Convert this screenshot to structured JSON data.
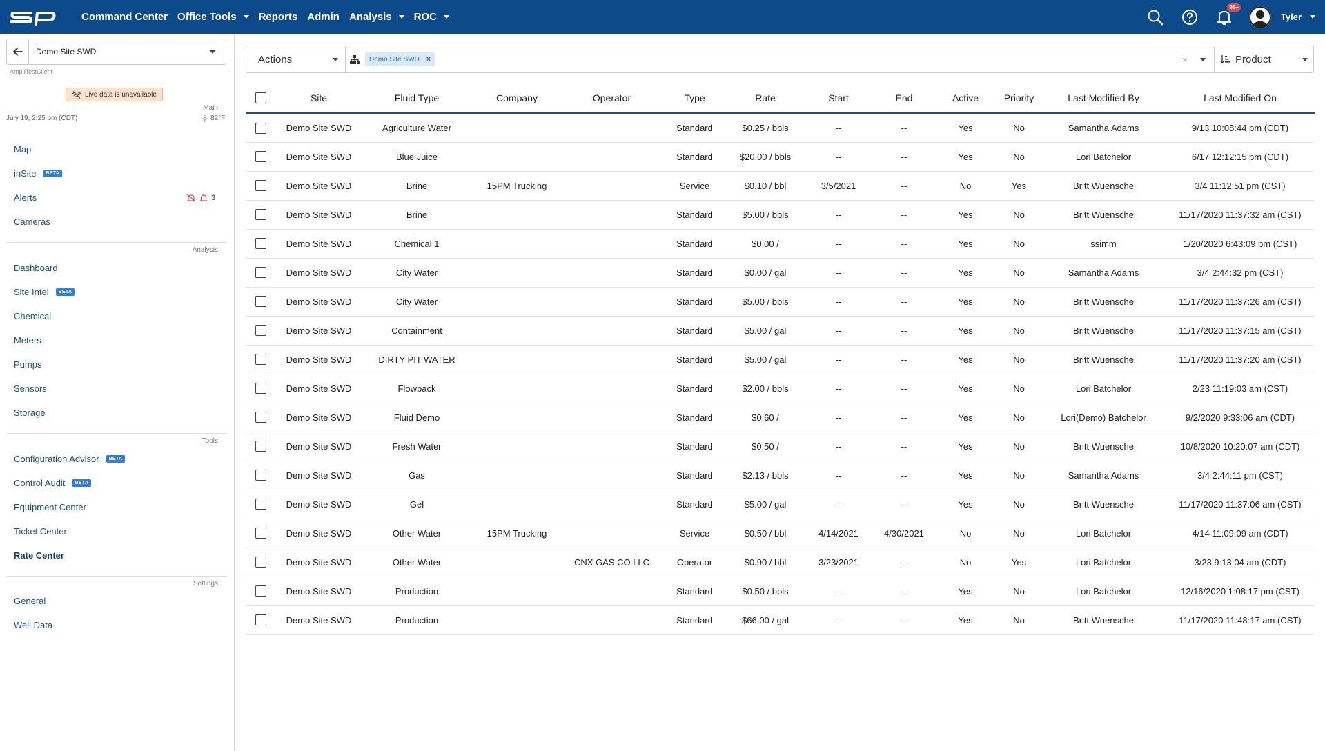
{
  "nav": {
    "items": [
      {
        "label": "Command Center",
        "caret": false
      },
      {
        "label": "Office Tools",
        "caret": true
      },
      {
        "label": "Reports",
        "caret": false
      },
      {
        "label": "Admin",
        "caret": false
      },
      {
        "label": "Analysis",
        "caret": true
      },
      {
        "label": "ROC",
        "caret": true
      }
    ],
    "notification_count": "99+",
    "user": "Tyler"
  },
  "sidebar": {
    "site": "Demo Site SWD",
    "client": "AmpliTestClient",
    "live_status": "Live data is unavailable",
    "datetime": "July 19, 2:25 pm (CDT)",
    "temperature": "82°F",
    "sections": {
      "main": "Main",
      "analysis": "Analysis",
      "tools": "Tools",
      "settings": "Settings"
    },
    "main_items": [
      {
        "label": "Map",
        "beta": false
      },
      {
        "label": "inSite",
        "beta": true
      },
      {
        "label": "Alerts",
        "beta": false
      },
      {
        "label": "Cameras",
        "beta": false
      }
    ],
    "alerts_count": "3",
    "analysis_items": [
      {
        "label": "Dashboard",
        "beta": false
      },
      {
        "label": "Site Intel",
        "beta": true
      },
      {
        "label": "Chemical",
        "beta": false
      },
      {
        "label": "Meters",
        "beta": false
      },
      {
        "label": "Pumps",
        "beta": false
      },
      {
        "label": "Sensors",
        "beta": false
      },
      {
        "label": "Storage",
        "beta": false
      }
    ],
    "tools_items": [
      {
        "label": "Configuration Advisor",
        "beta": true
      },
      {
        "label": "Control Audit",
        "beta": true
      },
      {
        "label": "Equipment Center",
        "beta": false
      },
      {
        "label": "Ticket Center",
        "beta": false
      },
      {
        "label": "Rate Center",
        "beta": false,
        "active": true
      }
    ],
    "settings_items": [
      {
        "label": "General",
        "beta": false
      },
      {
        "label": "Well Data",
        "beta": false
      }
    ],
    "beta_label": "BETA"
  },
  "toolbar": {
    "actions_label": "Actions",
    "filter_chip": "Demo Site SWD",
    "clear": "×",
    "group_label": "Product"
  },
  "table": {
    "headers": [
      "Site",
      "Fluid Type",
      "Company",
      "Operator",
      "Type",
      "Rate",
      "Start",
      "End",
      "Active",
      "Priority",
      "Last Modified By",
      "Last Modified On"
    ],
    "rows": [
      [
        "Demo Site SWD",
        "Agriculture Water",
        "",
        "",
        "Standard",
        "$0.25 / bbls",
        "--",
        "--",
        "Yes",
        "No",
        "Samantha Adams",
        "9/13 10:08:44 pm (CDT)"
      ],
      [
        "Demo Site SWD",
        "Blue Juice",
        "",
        "",
        "Standard",
        "$20.00 / bbls",
        "--",
        "--",
        "Yes",
        "No",
        "Lori Batchelor",
        "6/17 12:12:15 pm (CDT)"
      ],
      [
        "Demo Site SWD",
        "Brine",
        "15PM Trucking",
        "",
        "Service",
        "$0.10 / bbl",
        "3/5/2021",
        "--",
        "No",
        "Yes",
        "Britt Wuensche",
        "3/4 11:12:51 pm (CST)"
      ],
      [
        "Demo Site SWD",
        "Brine",
        "",
        "",
        "Standard",
        "$5.00 / bbls",
        "--",
        "--",
        "Yes",
        "No",
        "Britt Wuensche",
        "11/17/2020 11:37:32 am (CST)"
      ],
      [
        "Demo Site SWD",
        "Chemical 1",
        "",
        "",
        "Standard",
        "$0.00 /",
        "--",
        "--",
        "Yes",
        "No",
        "ssimm",
        "1/20/2020 6:43:09 pm (CST)"
      ],
      [
        "Demo Site SWD",
        "City Water",
        "",
        "",
        "Standard",
        "$0.00 / gal",
        "--",
        "--",
        "Yes",
        "No",
        "Samantha Adams",
        "3/4 2:44:32 pm (CST)"
      ],
      [
        "Demo Site SWD",
        "City Water",
        "",
        "",
        "Standard",
        "$5.00 / bbls",
        "--",
        "--",
        "Yes",
        "No",
        "Britt Wuensche",
        "11/17/2020 11:37:26 am (CST)"
      ],
      [
        "Demo Site SWD",
        "Containment",
        "",
        "",
        "Standard",
        "$5.00 / gal",
        "--",
        "--",
        "Yes",
        "No",
        "Britt Wuensche",
        "11/17/2020 11:37:15 am (CST)"
      ],
      [
        "Demo Site SWD",
        "DIRTY PIT WATER",
        "",
        "",
        "Standard",
        "$5.00 / gal",
        "--",
        "--",
        "Yes",
        "No",
        "Britt Wuensche",
        "11/17/2020 11:37:20 am (CST)"
      ],
      [
        "Demo Site SWD",
        "Flowback",
        "",
        "",
        "Standard",
        "$2.00 / bbls",
        "--",
        "--",
        "Yes",
        "No",
        "Lori Batchelor",
        "2/23 11:19:03 am (CST)"
      ],
      [
        "Demo Site SWD",
        "Fluid Demo",
        "",
        "",
        "Standard",
        "$0.60 /",
        "--",
        "--",
        "Yes",
        "No",
        "Lori(Demo) Batchelor",
        "9/2/2020 9:33:06 am (CDT)"
      ],
      [
        "Demo Site SWD",
        "Fresh Water",
        "",
        "",
        "Standard",
        "$0.50 /",
        "--",
        "--",
        "Yes",
        "No",
        "Britt Wuensche",
        "10/8/2020 10:20:07 am (CDT)"
      ],
      [
        "Demo Site SWD",
        "Gas",
        "",
        "",
        "Standard",
        "$2.13 / bbls",
        "--",
        "--",
        "Yes",
        "No",
        "Samantha Adams",
        "3/4 2:44:11 pm (CST)"
      ],
      [
        "Demo Site SWD",
        "Gel",
        "",
        "",
        "Standard",
        "$5.00 / gal",
        "--",
        "--",
        "Yes",
        "No",
        "Britt Wuensche",
        "11/17/2020 11:37:06 am (CST)"
      ],
      [
        "Demo Site SWD",
        "Other Water",
        "15PM Trucking",
        "",
        "Service",
        "$0.50 / bbl",
        "4/14/2021",
        "4/30/2021",
        "No",
        "No",
        "Lori Batchelor",
        "4/14 11:09:09 am (CDT)"
      ],
      [
        "Demo Site SWD",
        "Other Water",
        "",
        "CNX GAS CO LLC",
        "Operator",
        "$0.90 / bbl",
        "3/23/2021",
        "--",
        "No",
        "Yes",
        "Lori Batchelor",
        "3/23 9:13:04 am (CDT)"
      ],
      [
        "Demo Site SWD",
        "Production",
        "",
        "",
        "Standard",
        "$0.50 / bbls",
        "--",
        "--",
        "Yes",
        "No",
        "Lori Batchelor",
        "12/16/2020 1:08:17 pm (CST)"
      ],
      [
        "Demo Site SWD",
        "Production",
        "",
        "",
        "Standard",
        "$66.00 / gal",
        "--",
        "--",
        "Yes",
        "No",
        "Britt Wuensche",
        "11/17/2020 11:48:17 am (CST)"
      ]
    ]
  },
  "colors": {
    "nav_bg": "#0c4a8c",
    "link": "#1d4f8f",
    "beta": "#2f7de1",
    "alert_red": "#e04a4a"
  }
}
